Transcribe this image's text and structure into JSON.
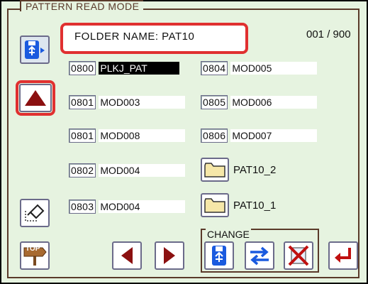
{
  "screen": {
    "title": "PATTERN READ MODE",
    "folder_name": "FOLDER NAME: PAT10",
    "counter": "001 / 900"
  },
  "patterns_left": [
    {
      "number": "0800",
      "name": "PLKJ_PAT",
      "selected": true
    },
    {
      "number": "0801",
      "name": "MOD003",
      "selected": false
    },
    {
      "number": "0801",
      "name": "MOD008",
      "selected": false
    },
    {
      "number": "0802",
      "name": "MOD004",
      "selected": false
    },
    {
      "number": "0803",
      "name": "MOD004",
      "selected": false
    }
  ],
  "patterns_right": [
    {
      "number": "0804",
      "name": "MOD005"
    },
    {
      "number": "0805",
      "name": "MOD006"
    },
    {
      "number": "0806",
      "name": "MOD007"
    }
  ],
  "folders": [
    {
      "name": "PAT10_2"
    },
    {
      "name": "PAT10_1"
    }
  ],
  "toolbar": {
    "change_label": "CHANGE",
    "top_label": "TOP"
  },
  "colors": {
    "background": "#e6f3e0",
    "highlight": "#e03030",
    "arrow_dark_red": "#8b1010",
    "blue": "#1a5adf"
  },
  "icons": {
    "usb_media": "usb-media-icon",
    "scroll_up": "scroll-up-arrow-icon",
    "eraser": "eraser-icon",
    "top": "top-signpost-icon",
    "prev": "left-arrow-icon",
    "next": "right-arrow-icon",
    "usb_change": "usb-change-icon",
    "swap": "swap-arrows-icon",
    "delete": "delete-x-icon",
    "enter": "enter-return-icon"
  }
}
